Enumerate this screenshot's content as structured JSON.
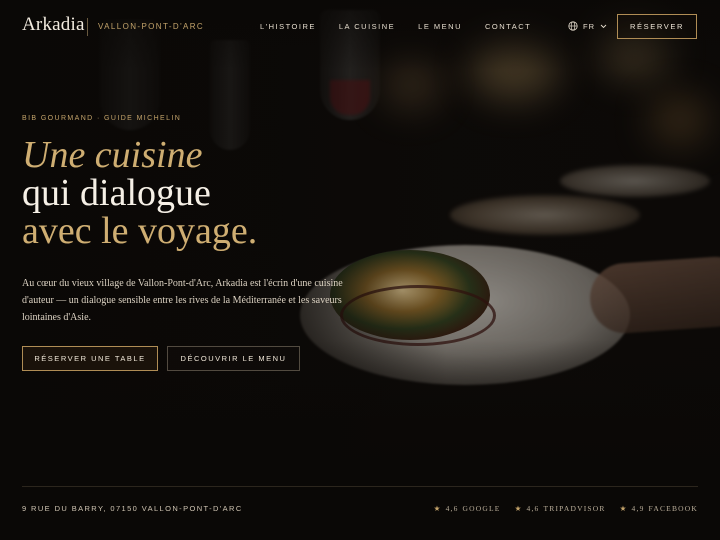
{
  "brand": {
    "name": "Arkadia",
    "place": "VALLON-PONT-D'ARC"
  },
  "nav": {
    "items": [
      "L'HISTOIRE",
      "LA CUISINE",
      "LE MENU",
      "CONTACT"
    ]
  },
  "lang": {
    "label": "FR",
    "icon": "globe-icon"
  },
  "header": {
    "reserve_label": "RÉSERVER"
  },
  "hero": {
    "eyebrow": "BIB GOURMAND · GUIDE MICHELIN",
    "line1": "Une cuisine",
    "line2": "qui dialogue",
    "line3": "avec le voyage.",
    "intro": "Au cœur du vieux village de Vallon-Pont-d'Arc, Arkadia est l'écrin d'une cuisine d'auteur — un dialogue sensible entre les rives de la Méditerranée et les saveurs lointaines d'Asie.",
    "cta_primary": "RÉSERVER UNE TABLE",
    "cta_secondary": "DÉCOUVRIR LE MENU"
  },
  "footer": {
    "address": "9 RUE DU BARRY, 07150 VALLON-PONT-D'ARC",
    "ratings": [
      {
        "score": "4,6",
        "source": "GOOGLE"
      },
      {
        "score": "4,6",
        "source": "TRIPADVISOR"
      },
      {
        "score": "4,9",
        "source": "FACEBOOK"
      }
    ]
  },
  "colors": {
    "accent": "#c3a36a",
    "background": "#0d0a08",
    "text": "#efe6d6"
  }
}
